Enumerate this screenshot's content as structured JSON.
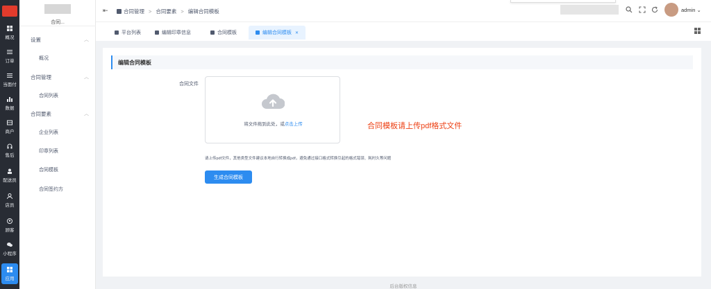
{
  "rail": {
    "items": [
      {
        "label": "概况",
        "icon": "dashboard-icon"
      },
      {
        "label": "订单",
        "icon": "list-icon"
      },
      {
        "label": "当面付",
        "icon": "list-icon"
      },
      {
        "label": "数据",
        "icon": "bar-chart-icon"
      },
      {
        "label": "商户",
        "icon": "store-icon"
      },
      {
        "label": "售后",
        "icon": "headset-icon"
      },
      {
        "label": "配送员",
        "icon": "courier-icon"
      },
      {
        "label": "店员",
        "icon": "user-icon"
      },
      {
        "label": "顾客",
        "icon": "customer-icon"
      },
      {
        "label": "小程序",
        "icon": "chat-icon"
      },
      {
        "label": "应用",
        "icon": "apps-icon"
      }
    ],
    "active": "应用"
  },
  "sidebar": {
    "title": "合同...",
    "groups": [
      {
        "label": "设置",
        "items": [
          "概况"
        ]
      },
      {
        "label": "合同管理",
        "items": [
          "合同列表"
        ]
      },
      {
        "label": "合同要素",
        "items": [
          "企业列表",
          "印章列表",
          "合同模板",
          "合同签约方"
        ]
      }
    ]
  },
  "header": {
    "breadcrumb": [
      "合同管理",
      "合同要素",
      "编辑合同模板"
    ],
    "user": "admin"
  },
  "tabs": [
    {
      "label": "平台列表",
      "active": false
    },
    {
      "label": "编辑印章信息",
      "active": false
    },
    {
      "label": "合同模板",
      "active": false
    },
    {
      "label": "编辑合同模板",
      "active": true
    }
  ],
  "form": {
    "section_title": "编辑合同模板",
    "file_label": "合同文件",
    "upload_text": "将文件拖到此处，或",
    "upload_link": "点击上传",
    "red_note": "合同模板请上传pdf格式文件",
    "hint": "请上传pdf文件，其他类型文件建议本地自行转换成pdf，避免通过接口格式转换引起的格式错误、耗时久等问题",
    "submit_label": "生成合同模板"
  },
  "footer": "后台版权信息",
  "colors": {
    "primary": "#2d8cf0",
    "rail_bg": "#282c34",
    "note_red": "#ed4014"
  }
}
